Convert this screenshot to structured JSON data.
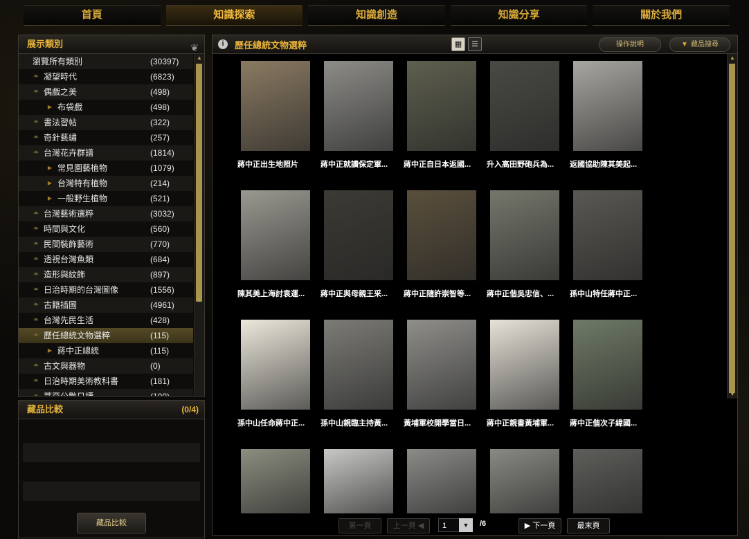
{
  "nav": [
    "首頁",
    "知識探索",
    "知識創造",
    "知識分享",
    "關於我們"
  ],
  "categories_panel": {
    "title": "展示類別",
    "items": [
      {
        "label": "瀏覽所有類別",
        "count": "(30397)",
        "level": "plain"
      },
      {
        "label": "凝望時代",
        "count": "(6823)",
        "level": "top"
      },
      {
        "label": "偶戲之美",
        "count": "(498)",
        "level": "top"
      },
      {
        "label": "布袋戲",
        "count": "(498)",
        "level": "sub"
      },
      {
        "label": "書法習帖",
        "count": "(322)",
        "level": "top"
      },
      {
        "label": "奇針藝繡",
        "count": "(257)",
        "level": "top"
      },
      {
        "label": "台灣花卉群譜",
        "count": "(1814)",
        "level": "top"
      },
      {
        "label": "常見園藝植物",
        "count": "(1079)",
        "level": "sub"
      },
      {
        "label": "台灣特有植物",
        "count": "(214)",
        "level": "sub"
      },
      {
        "label": "一般野生植物",
        "count": "(521)",
        "level": "sub"
      },
      {
        "label": "台灣藝術選粹",
        "count": "(3032)",
        "level": "top"
      },
      {
        "label": "時間與文化",
        "count": "(560)",
        "level": "top"
      },
      {
        "label": "民間裝飾藝術",
        "count": "(770)",
        "level": "top"
      },
      {
        "label": "透視台灣魚類",
        "count": "(684)",
        "level": "top"
      },
      {
        "label": "造形與紋飾",
        "count": "(897)",
        "level": "top"
      },
      {
        "label": "日治時期的台灣圖像",
        "count": "(1556)",
        "level": "top"
      },
      {
        "label": "古籍插圖",
        "count": "(4961)",
        "level": "top"
      },
      {
        "label": "台灣先民生活",
        "count": "(428)",
        "level": "top"
      },
      {
        "label": "歷任總統文物選粹",
        "count": "(115)",
        "level": "top",
        "active": true
      },
      {
        "label": "蔣中正總統",
        "count": "(115)",
        "level": "sub"
      },
      {
        "label": "古文與器物",
        "count": "(0)",
        "level": "top"
      },
      {
        "label": "日治時期美術教科書",
        "count": "(181)",
        "level": "top"
      },
      {
        "label": "蒂亞公數日標",
        "count": "(100)",
        "level": "top"
      }
    ]
  },
  "compare_panel": {
    "title": "藏品比較",
    "count": "(0/4)",
    "button": "藏品比較"
  },
  "main": {
    "title": "歷任總統文物選粹",
    "help_button": "操作說明",
    "search_button": "藏品搜尋",
    "items": [
      {
        "caption": "蔣中正出生地照片",
        "tone": "#8a7a62"
      },
      {
        "caption": "蔣中正就讀保定軍...",
        "tone": "#8d8c88"
      },
      {
        "caption": "蔣中正自日本返國...",
        "tone": "#5e5f4e"
      },
      {
        "caption": "升入高田野砲兵為...",
        "tone": "#4a4a44"
      },
      {
        "caption": "返國協助陳其美起...",
        "tone": "#a8a6a0"
      },
      {
        "caption": "陳其美上海討袁運...",
        "tone": "#9a9890"
      },
      {
        "caption": "蔣中正與母親王采...",
        "tone": "#3c3a34"
      },
      {
        "caption": "蔣中正隨許崇智等...",
        "tone": "#5a4f3c"
      },
      {
        "caption": "蔣中正偕吳忠信、...",
        "tone": "#75776c"
      },
      {
        "caption": "孫中山特任蔣中正...",
        "tone": "#5a5852"
      },
      {
        "caption": "孫中山任命蔣中正...",
        "tone": "#ece8dc"
      },
      {
        "caption": "孫中山親臨主持黃...",
        "tone": "#7c7b76"
      },
      {
        "caption": "黃埔軍校開學當日...",
        "tone": "#8f8e8a"
      },
      {
        "caption": "蔣中正親書黃埔軍...",
        "tone": "#e6e2d8"
      },
      {
        "caption": "蔣中正偕次子緯國...",
        "tone": "#6f7a66"
      },
      {
        "caption": "",
        "tone": "#8c8e80"
      },
      {
        "caption": "",
        "tone": "#c8c8c6"
      },
      {
        "caption": "",
        "tone": "#8b8b88"
      },
      {
        "caption": "",
        "tone": "#8a8a84"
      },
      {
        "caption": "",
        "tone": "#5e5e5a"
      }
    ]
  },
  "pager": {
    "first": "第一頁",
    "prev": "上一頁",
    "current": "1",
    "total": "/6",
    "next": "下一頁",
    "last": "最末頁"
  }
}
